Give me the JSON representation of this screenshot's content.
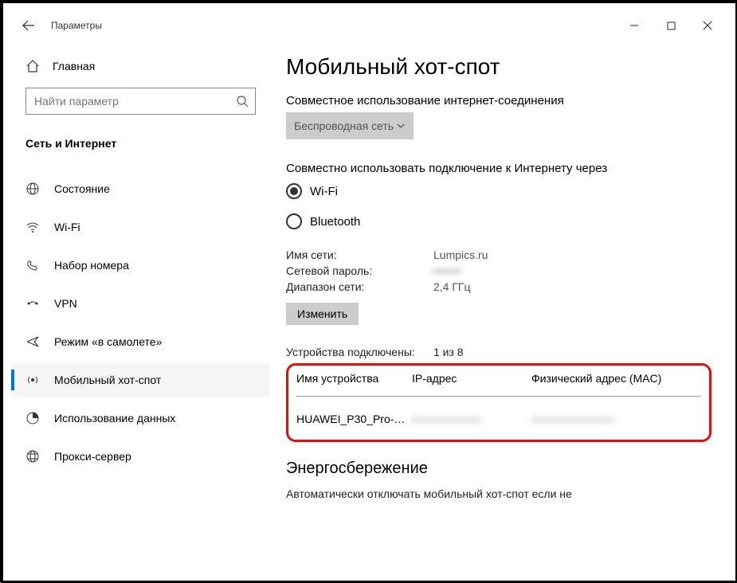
{
  "window": {
    "title": "Параметры"
  },
  "sidebar": {
    "home_label": "Главная",
    "search_placeholder": "Найти параметр",
    "category": "Сеть и Интернет",
    "items": [
      {
        "label": "Состояние"
      },
      {
        "label": "Wi-Fi"
      },
      {
        "label": "Набор номера"
      },
      {
        "label": "VPN"
      },
      {
        "label": "Режим «в самолете»"
      },
      {
        "label": "Мобильный хот-спот"
      },
      {
        "label": "Использование данных"
      },
      {
        "label": "Прокси-сервер"
      }
    ]
  },
  "main": {
    "title": "Мобильный хот-спот",
    "share_label": "Совместное использование интернет-соединения",
    "share_dropdown": "Беспроводная сеть",
    "share_over_label": "Совместно использовать подключение к Интернету через",
    "radio_wifi": "Wi-Fi",
    "radio_bt": "Bluetooth",
    "net_name_key": "Имя сети:",
    "net_name_val": "Lumpics.ru",
    "net_pass_key": "Сетевой пароль:",
    "net_pass_val": "••••••",
    "net_band_key": "Диапазон сети:",
    "net_band_val": "2,4 ГГц",
    "edit_btn": "Изменить",
    "devices_key": "Устройства подключены:",
    "devices_val": "1 из 8",
    "col_device": "Имя устройства",
    "col_ip": "IP-адрес",
    "col_mac": "Физический адрес (MAC)",
    "row1_device": "HUAWEI_P30_Pro-…",
    "row1_ip": "xxxxxxxxxxx",
    "row1_mac": "xxxxxxxxxxxxx",
    "energy_title": "Энергосбережение",
    "energy_cut": "Автоматически отключать мобильный хот-спот если не"
  }
}
